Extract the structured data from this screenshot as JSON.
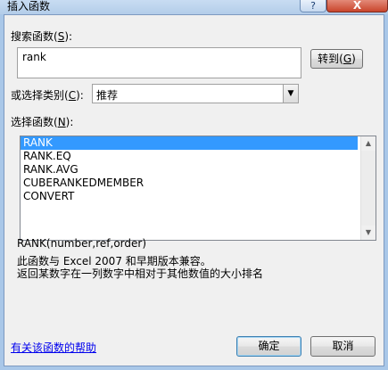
{
  "window": {
    "title": "插入函数",
    "help_btn": "?",
    "close_btn": "X"
  },
  "search": {
    "label_pre": "搜索函数(",
    "label_key": "S",
    "label_post": "):",
    "value": "rank",
    "go_label_pre": "转到(",
    "go_label_key": "G",
    "go_label_post": ")"
  },
  "category": {
    "label_pre": "或选择类别(",
    "label_key": "C",
    "label_post": "):",
    "selected": "推荐"
  },
  "functions": {
    "label_pre": "选择函数(",
    "label_key": "N",
    "label_post": "):",
    "items": [
      "RANK",
      "RANK.EQ",
      "RANK.AVG",
      "CUBERANKEDMEMBER",
      "CONVERT"
    ],
    "selected_index": 0
  },
  "description": {
    "syntax": "RANK(number,ref,order)",
    "line1": "此函数与 Excel 2007 和早期版本兼容。",
    "line2": "返回某数字在一列数字中相对于其他数值的大小排名"
  },
  "footer": {
    "help_link": "有关该函数的帮助",
    "ok": "确定",
    "cancel": "取消"
  }
}
